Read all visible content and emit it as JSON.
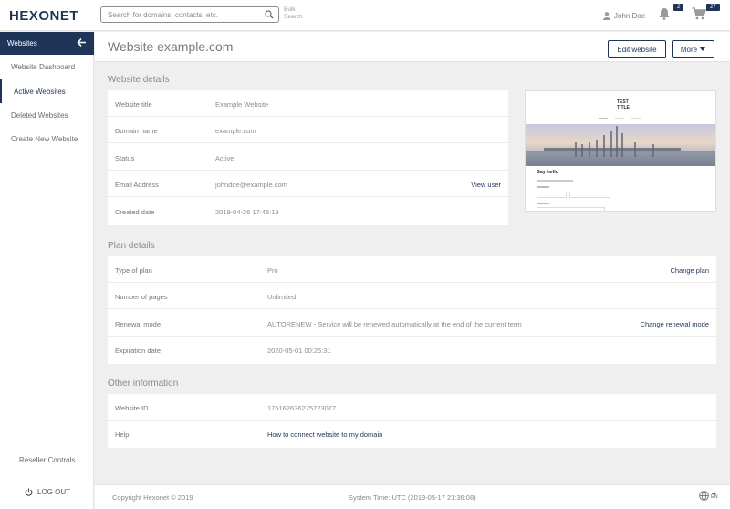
{
  "brand": {
    "logo": "HEXONET",
    "accent": "#1f3557"
  },
  "search": {
    "placeholder": "Search for domains, contacts, etc.",
    "icon": "search-icon",
    "bulk_label_1": "Bulk",
    "bulk_label_2": "Search"
  },
  "user": {
    "name": "John Doe",
    "icon": "user-icon"
  },
  "notifications": {
    "count": "2",
    "icon": "bell-icon"
  },
  "cart": {
    "count": "27",
    "icon": "cart-icon"
  },
  "sidebar": {
    "header": "Websites",
    "items": [
      {
        "label": "Website Dashboard"
      },
      {
        "label": "Active Websites"
      },
      {
        "label": "Deleted Websites"
      },
      {
        "label": "Create New Website"
      }
    ],
    "reseller": "Reseller Controls",
    "logout": "LOG OUT"
  },
  "page": {
    "title": "Website example.com",
    "edit_button": "Edit website",
    "more_button": "More"
  },
  "website_details": {
    "title": "Website details",
    "rows": [
      {
        "label": "Website title",
        "value": "Example Website",
        "action": ""
      },
      {
        "label": "Domain name",
        "value": "example.com",
        "action": ""
      },
      {
        "label": "Status",
        "value": "Active",
        "action": ""
      },
      {
        "label": "Email Address",
        "value": "johndoe@example.com",
        "action": "View user"
      },
      {
        "label": "Created date",
        "value": "2019-04-26 17:46:19",
        "action": ""
      }
    ]
  },
  "preview": {
    "heading_1": "TEST",
    "heading_2": "TITLE",
    "section": "Say hello"
  },
  "plan_details": {
    "title": "Plan details",
    "rows": [
      {
        "label": "Type of plan",
        "value": "Pro",
        "action": "Change plan"
      },
      {
        "label": "Number of pages",
        "value": "Unlimited",
        "action": ""
      },
      {
        "label": "Renewal mode",
        "value": "AUTORENEW - Service will be renewed automatically at the end of the current term",
        "action": "Change renewal mode"
      },
      {
        "label": "Expiration date",
        "value": "2020-05-01 00:26:31",
        "action": ""
      }
    ]
  },
  "other_info": {
    "title": "Other information",
    "rows": [
      {
        "label": "Website ID",
        "value": "175162636275723077"
      },
      {
        "label": "Help",
        "value": "How to connect website to my domain"
      }
    ]
  },
  "footer": {
    "copyright": "Copyright Hexonet © 2019",
    "system_time": "System Time: UTC (2019-05-17 21:36:08)",
    "language": "EN"
  }
}
